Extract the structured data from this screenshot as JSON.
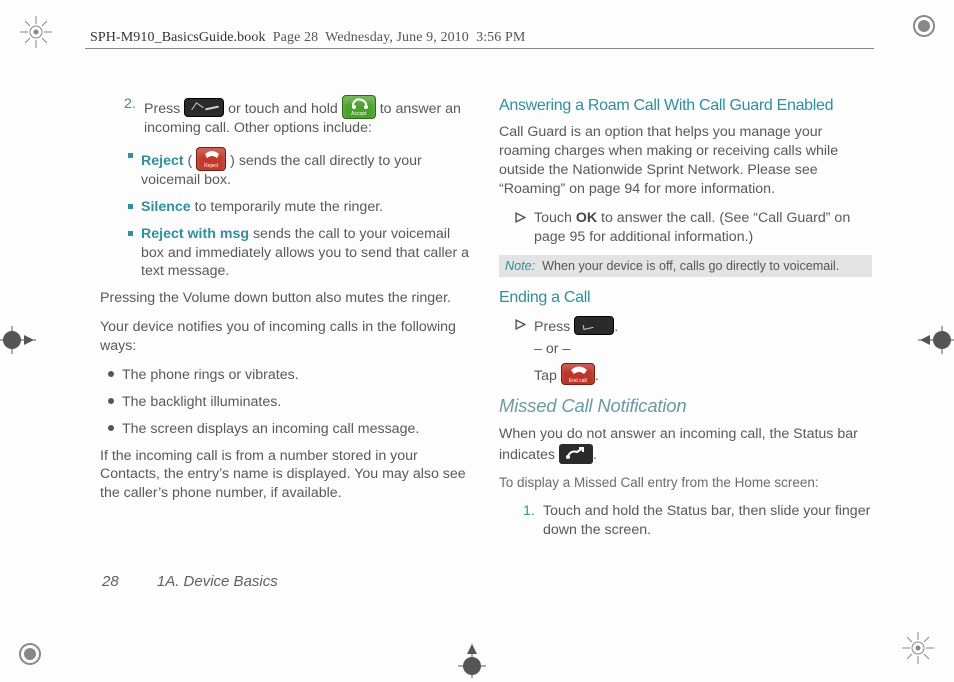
{
  "header": {
    "doc_title": "SPH-M910_BasicsGuide.book",
    "page_ref": "Page 28",
    "day": "Wednesday, June 9, 2010",
    "time": "3:56 PM"
  },
  "left_col": {
    "step2_a": "Press ",
    "step2_b": " or touch and hold ",
    "step2_c": " to answer an incoming call. Other options include:",
    "reject_label": "Reject",
    "reject_text": " sends the call directly to your voicemail box.",
    "silence_label": "Silence",
    "silence_text": " to temporarily mute the ringer.",
    "rwm_label": "Reject with msg",
    "rwm_text": " sends the call to your voicemail box and immediately allows you to send that caller a text message.",
    "vol_para": "Pressing the Volume down button also mutes the ringer.",
    "notify_para": "Your device notifies you of incoming calls in the following ways:",
    "n1": "The phone rings or vibrates.",
    "n2": "The backlight illuminates.",
    "n3": "The screen displays an incoming call message.",
    "contacts_para": "If the incoming call is from a number stored in your Contacts, the entry’s name is displayed. You may also see the caller’s phone number, if available."
  },
  "right_col": {
    "h_roam": "Answering a Roam Call With Call Guard Enabled",
    "roam_para": "Call Guard is an option that helps you manage your roaming charges when making or receiving calls while outside the Nationwide Sprint Network. Please see “Roaming” on page 94 for more information.",
    "roam_step_a": "Touch ",
    "roam_step_ok": "OK",
    "roam_step_b": " to answer the call. (See “Call Guard” on page 95 for additional information.)",
    "note_label": "Note:",
    "note_text": "When your device is off, calls go directly to voicemail.",
    "h_end": "Ending a Call",
    "end_press": "Press ",
    "end_or": "– or –",
    "end_tap": "Tap ",
    "h_missed": "Missed Call Notification",
    "missed_para_a": "When you do not answer an incoming call, the Status bar indicates ",
    "missed_para_b": ".",
    "missed_sub": "To display a Missed Call entry from the Home screen:",
    "missed_step": "Touch and hold the Status bar, then slide your finger down the screen."
  },
  "icons": {
    "accept": "Accept",
    "reject": "Reject",
    "endcall": "End call"
  },
  "footer": {
    "page": "28",
    "section": "1A. Device Basics"
  }
}
